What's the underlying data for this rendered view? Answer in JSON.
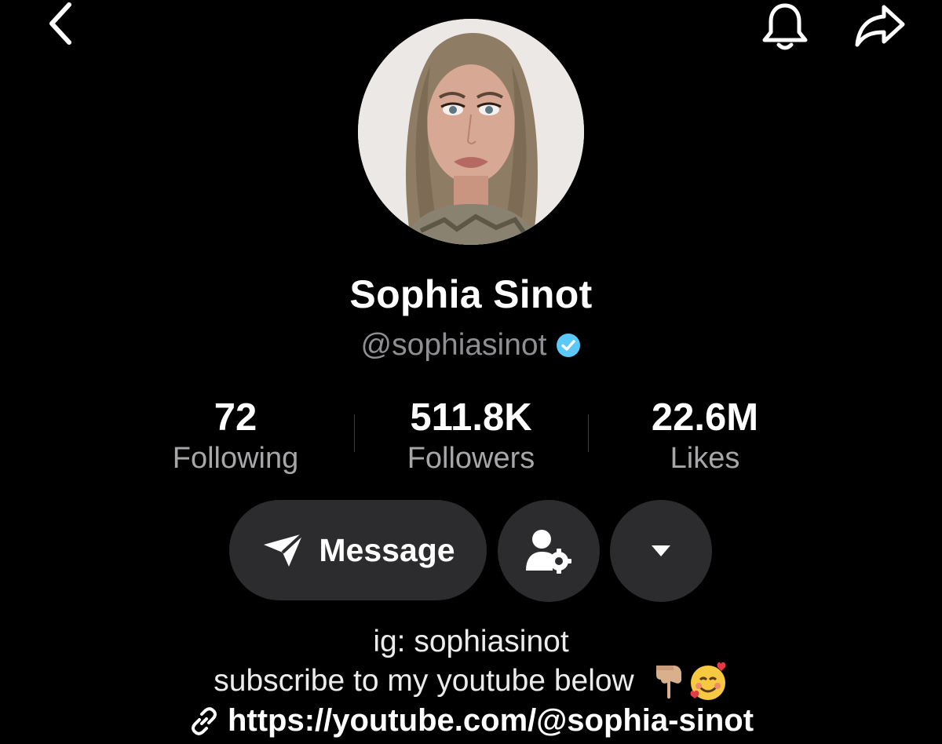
{
  "header": {
    "back_icon": "chevron-left-icon",
    "bell_icon": "bell-icon",
    "share_icon": "share-arrow-icon"
  },
  "profile": {
    "display_name": "Sophia Sinot",
    "handle": "@sophiasinot",
    "verified": true,
    "verified_color": "#5ac8fa"
  },
  "stats": [
    {
      "value": "72",
      "label": "Following"
    },
    {
      "value": "511.8K",
      "label": "Followers"
    },
    {
      "value": "22.6M",
      "label": "Likes"
    }
  ],
  "actions": {
    "message_label": "Message",
    "message_icon": "send-icon",
    "friend_settings_icon": "user-gear-icon",
    "more_icon": "caret-down-icon"
  },
  "bio": {
    "line1": "ig: sophiasinot",
    "line2": "subscribe to my youtube below",
    "line2_emojis": "👇🏼🥰",
    "link": "https://youtube.com/@sophia-sinot",
    "link_icon": "link-icon"
  },
  "colors": {
    "background": "#000000",
    "button_bg": "#2c2c2e",
    "muted_text": "#a7a7aa"
  }
}
